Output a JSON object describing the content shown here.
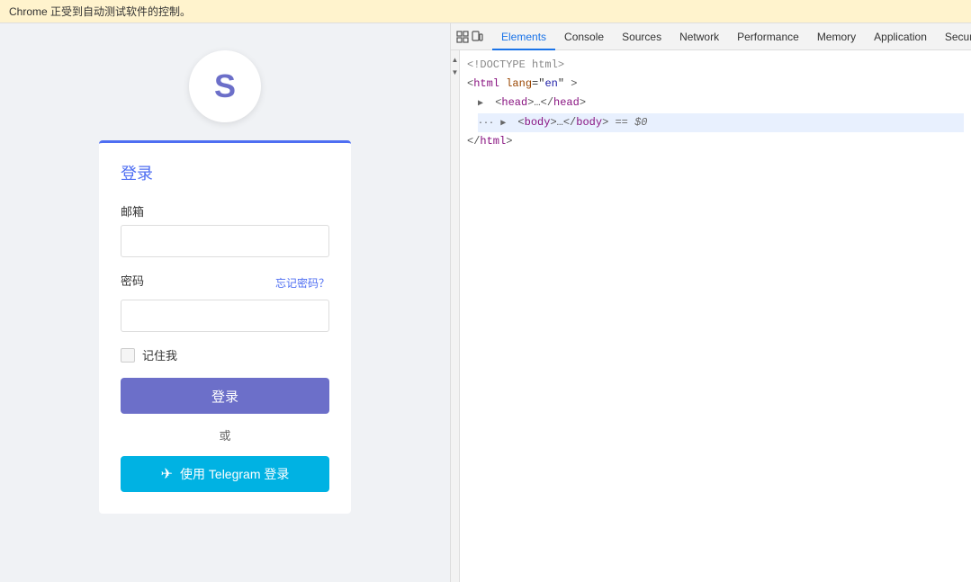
{
  "chrome_bar": {
    "text": "Chrome 正受到自动测试软件的控制。"
  },
  "login": {
    "logo_letter": "S",
    "title": "登录",
    "email_label": "邮箱",
    "email_placeholder": "",
    "password_label": "密码",
    "password_placeholder": "",
    "forgot_password": "忘记密码？",
    "remember_me": "记住我",
    "login_button": "登录",
    "or_text": "或",
    "telegram_button": "使用 Telegram 登录",
    "telegram_prefix": "✈"
  },
  "devtools": {
    "tabs": [
      {
        "label": "Elements",
        "active": true
      },
      {
        "label": "Console",
        "active": false
      },
      {
        "label": "Sources",
        "active": false
      },
      {
        "label": "Network",
        "active": false
      },
      {
        "label": "Performance",
        "active": false
      },
      {
        "label": "Memory",
        "active": false
      },
      {
        "label": "Application",
        "active": false
      },
      {
        "label": "Security",
        "active": false
      }
    ],
    "html_lines": [
      {
        "text": "<!DOCTYPE html>",
        "type": "doctype",
        "indent": 0
      },
      {
        "text": "<html lang=\"en\">",
        "type": "tag",
        "indent": 0
      },
      {
        "text": "▶ <head>…</head>",
        "type": "collapsed",
        "indent": 1
      },
      {
        "text": "▶ <body>…</body> == $0",
        "type": "collapsed-selected",
        "indent": 1
      },
      {
        "text": "</html>",
        "type": "tag",
        "indent": 0
      }
    ]
  }
}
